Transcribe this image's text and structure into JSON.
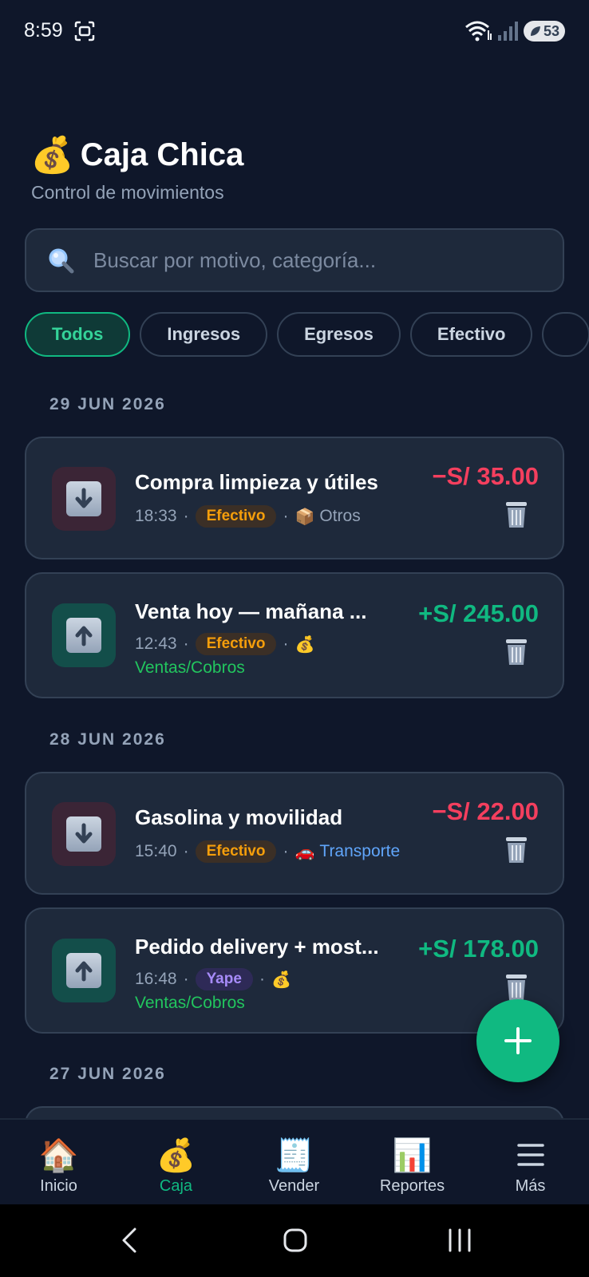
{
  "status_bar": {
    "time": "8:59",
    "battery": "53",
    "icons": [
      "screenshot-icon",
      "wifi-icon",
      "signal-icon",
      "battery-icon"
    ]
  },
  "header": {
    "title_emoji": "💰",
    "title": "Caja Chica",
    "subtitle": "Control de movimientos"
  },
  "search": {
    "placeholder": "Buscar por motivo, categoría...",
    "value": ""
  },
  "filters": {
    "chips": [
      "Todos",
      "Ingresos",
      "Egresos",
      "Efectivo"
    ],
    "selected": "Todos"
  },
  "groups": [
    {
      "date": "29 JUN 2026",
      "items": [
        {
          "title": "Compra limpieza y útiles",
          "time": "18:33",
          "method": "Efectivo",
          "category_emoji": "📦",
          "category": "Otros",
          "amount": "−S/ 35.00",
          "type": "egreso"
        },
        {
          "title": "Venta hoy — mañana ...",
          "time": "12:43",
          "method": "Efectivo",
          "category_emoji": "💰",
          "category": "Ventas/Cobros",
          "amount": "+S/ 245.00",
          "type": "ingreso"
        }
      ]
    },
    {
      "date": "28 JUN 2026",
      "items": [
        {
          "title": "Gasolina y movilidad",
          "time": "15:40",
          "method": "Efectivo",
          "category_emoji": "🚗",
          "category": "Transporte",
          "amount": "−S/ 22.00",
          "type": "egreso"
        },
        {
          "title": "Pedido delivery + most...",
          "time": "16:48",
          "method": "Yape",
          "category_emoji": "💰",
          "category": "Ventas/Cobros",
          "amount": "+S/ 178.00",
          "type": "ingreso"
        }
      ]
    },
    {
      "date": "27 JUN 2026",
      "items": []
    }
  ],
  "fab": {
    "icon": "plus-icon"
  },
  "bottom_nav": {
    "items": [
      {
        "label": "Inicio",
        "icon": "🏠"
      },
      {
        "label": "Caja",
        "icon": "💰"
      },
      {
        "label": "Vender",
        "icon": "🧾"
      },
      {
        "label": "Reportes",
        "icon": "📊"
      },
      {
        "label": "Más",
        "icon": "menu-icon"
      }
    ],
    "active": "Caja"
  },
  "colors": {
    "background": "#0f172a",
    "card": "#1e293b",
    "accent": "#10b981",
    "negative": "#f43f5e",
    "efectivo_badge": "#f59e0b",
    "yape_badge": "#a78bfa"
  }
}
